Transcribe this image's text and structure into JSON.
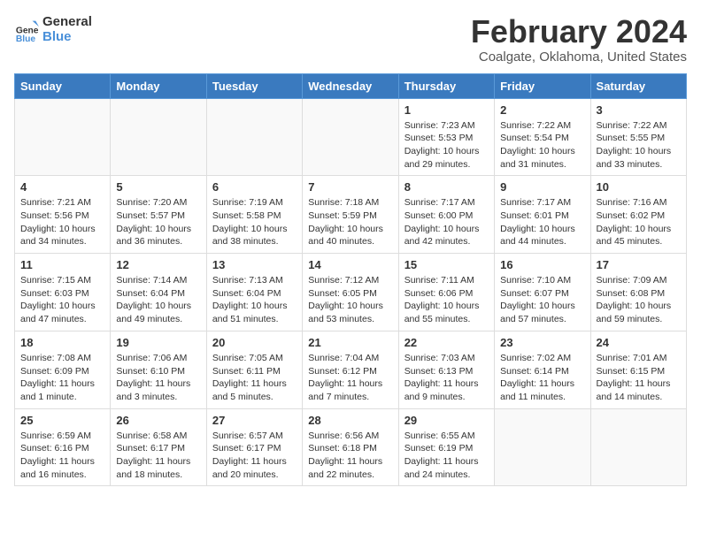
{
  "header": {
    "logo_general": "General",
    "logo_blue": "Blue",
    "main_title": "February 2024",
    "sub_title": "Coalgate, Oklahoma, United States"
  },
  "weekdays": [
    "Sunday",
    "Monday",
    "Tuesday",
    "Wednesday",
    "Thursday",
    "Friday",
    "Saturday"
  ],
  "weeks": [
    [
      {
        "day": "",
        "info": ""
      },
      {
        "day": "",
        "info": ""
      },
      {
        "day": "",
        "info": ""
      },
      {
        "day": "",
        "info": ""
      },
      {
        "day": "1",
        "info": "Sunrise: 7:23 AM\nSunset: 5:53 PM\nDaylight: 10 hours\nand 29 minutes."
      },
      {
        "day": "2",
        "info": "Sunrise: 7:22 AM\nSunset: 5:54 PM\nDaylight: 10 hours\nand 31 minutes."
      },
      {
        "day": "3",
        "info": "Sunrise: 7:22 AM\nSunset: 5:55 PM\nDaylight: 10 hours\nand 33 minutes."
      }
    ],
    [
      {
        "day": "4",
        "info": "Sunrise: 7:21 AM\nSunset: 5:56 PM\nDaylight: 10 hours\nand 34 minutes."
      },
      {
        "day": "5",
        "info": "Sunrise: 7:20 AM\nSunset: 5:57 PM\nDaylight: 10 hours\nand 36 minutes."
      },
      {
        "day": "6",
        "info": "Sunrise: 7:19 AM\nSunset: 5:58 PM\nDaylight: 10 hours\nand 38 minutes."
      },
      {
        "day": "7",
        "info": "Sunrise: 7:18 AM\nSunset: 5:59 PM\nDaylight: 10 hours\nand 40 minutes."
      },
      {
        "day": "8",
        "info": "Sunrise: 7:17 AM\nSunset: 6:00 PM\nDaylight: 10 hours\nand 42 minutes."
      },
      {
        "day": "9",
        "info": "Sunrise: 7:17 AM\nSunset: 6:01 PM\nDaylight: 10 hours\nand 44 minutes."
      },
      {
        "day": "10",
        "info": "Sunrise: 7:16 AM\nSunset: 6:02 PM\nDaylight: 10 hours\nand 45 minutes."
      }
    ],
    [
      {
        "day": "11",
        "info": "Sunrise: 7:15 AM\nSunset: 6:03 PM\nDaylight: 10 hours\nand 47 minutes."
      },
      {
        "day": "12",
        "info": "Sunrise: 7:14 AM\nSunset: 6:04 PM\nDaylight: 10 hours\nand 49 minutes."
      },
      {
        "day": "13",
        "info": "Sunrise: 7:13 AM\nSunset: 6:04 PM\nDaylight: 10 hours\nand 51 minutes."
      },
      {
        "day": "14",
        "info": "Sunrise: 7:12 AM\nSunset: 6:05 PM\nDaylight: 10 hours\nand 53 minutes."
      },
      {
        "day": "15",
        "info": "Sunrise: 7:11 AM\nSunset: 6:06 PM\nDaylight: 10 hours\nand 55 minutes."
      },
      {
        "day": "16",
        "info": "Sunrise: 7:10 AM\nSunset: 6:07 PM\nDaylight: 10 hours\nand 57 minutes."
      },
      {
        "day": "17",
        "info": "Sunrise: 7:09 AM\nSunset: 6:08 PM\nDaylight: 10 hours\nand 59 minutes."
      }
    ],
    [
      {
        "day": "18",
        "info": "Sunrise: 7:08 AM\nSunset: 6:09 PM\nDaylight: 11 hours\nand 1 minute."
      },
      {
        "day": "19",
        "info": "Sunrise: 7:06 AM\nSunset: 6:10 PM\nDaylight: 11 hours\nand 3 minutes."
      },
      {
        "day": "20",
        "info": "Sunrise: 7:05 AM\nSunset: 6:11 PM\nDaylight: 11 hours\nand 5 minutes."
      },
      {
        "day": "21",
        "info": "Sunrise: 7:04 AM\nSunset: 6:12 PM\nDaylight: 11 hours\nand 7 minutes."
      },
      {
        "day": "22",
        "info": "Sunrise: 7:03 AM\nSunset: 6:13 PM\nDaylight: 11 hours\nand 9 minutes."
      },
      {
        "day": "23",
        "info": "Sunrise: 7:02 AM\nSunset: 6:14 PM\nDaylight: 11 hours\nand 11 minutes."
      },
      {
        "day": "24",
        "info": "Sunrise: 7:01 AM\nSunset: 6:15 PM\nDaylight: 11 hours\nand 14 minutes."
      }
    ],
    [
      {
        "day": "25",
        "info": "Sunrise: 6:59 AM\nSunset: 6:16 PM\nDaylight: 11 hours\nand 16 minutes."
      },
      {
        "day": "26",
        "info": "Sunrise: 6:58 AM\nSunset: 6:17 PM\nDaylight: 11 hours\nand 18 minutes."
      },
      {
        "day": "27",
        "info": "Sunrise: 6:57 AM\nSunset: 6:17 PM\nDaylight: 11 hours\nand 20 minutes."
      },
      {
        "day": "28",
        "info": "Sunrise: 6:56 AM\nSunset: 6:18 PM\nDaylight: 11 hours\nand 22 minutes."
      },
      {
        "day": "29",
        "info": "Sunrise: 6:55 AM\nSunset: 6:19 PM\nDaylight: 11 hours\nand 24 minutes."
      },
      {
        "day": "",
        "info": ""
      },
      {
        "day": "",
        "info": ""
      }
    ]
  ]
}
